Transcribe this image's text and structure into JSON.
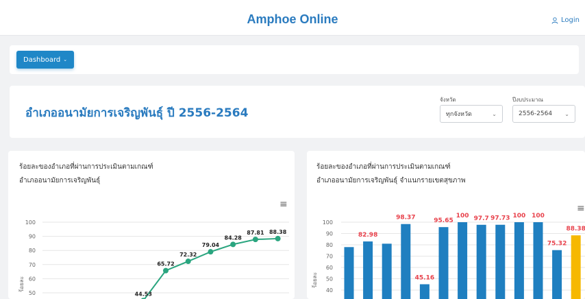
{
  "header": {
    "brand": "Amphoe Online",
    "login_label": "Login"
  },
  "menu": {
    "dashboard_label": "Dashboard"
  },
  "page": {
    "title": "อำเภออนามัยการเจริญพันธุ์ ปี 2556-2564",
    "filters": [
      {
        "label": "จังหวัด",
        "value": "ทุกจังหวัด"
      },
      {
        "label": "ปีงบประมาณ",
        "value": "2556-2564"
      }
    ]
  },
  "charts": {
    "left": {
      "title_line1": "ร้อยละของอำเภอที่ผ่านการประเมินตามเกณฑ์",
      "title_line2": "อำเภออนามัยการเจริญพันธุ์"
    },
    "right": {
      "title_line1": "ร้อยละของอำเภอที่ผ่านการประเมินตามเกณฑ์",
      "title_line2": "อำเภออนามัยการเจริญพันธุ์ จำแนกรายเขตสุขภาพ"
    }
  },
  "colors": {
    "accent": "#2a7bbf",
    "line": "#2aa57f",
    "bar": "#1f7fc0",
    "bar_highlight": "#f6b800",
    "bar_label": "#e8414b"
  },
  "chart_data": [
    {
      "type": "line",
      "ylabel": "ร้อยละ",
      "y_ticks": [
        100,
        90,
        80,
        70,
        60,
        50
      ],
      "ylim": [
        40,
        100
      ],
      "grid": true,
      "values": [
        null,
        null,
        null,
        null,
        44.53,
        65.72,
        72.32,
        79.04,
        84.28,
        87.81,
        88.38
      ]
    },
    {
      "type": "bar",
      "ylabel": "ร้อยละ",
      "y_ticks": [
        100,
        90,
        80,
        70,
        60,
        50,
        40
      ],
      "ylim": [
        35,
        100
      ],
      "grid": true,
      "values": [
        78,
        82.98,
        81,
        98.37,
        45.16,
        95.65,
        100,
        97.7,
        97.73,
        100,
        100,
        75.32,
        88.38
      ],
      "labels": [
        "",
        "82.98",
        "",
        "98.37",
        "45.16",
        "95.65",
        "100",
        "97.7",
        "97.73",
        "100",
        "100",
        "75.32",
        "88.38"
      ]
    }
  ]
}
